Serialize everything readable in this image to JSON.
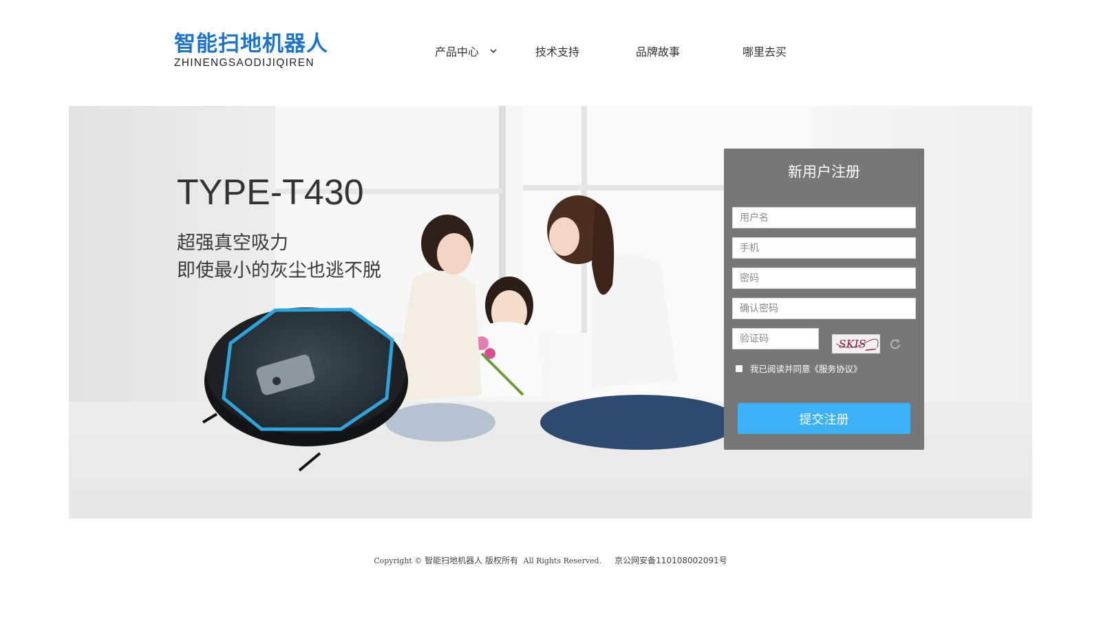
{
  "header": {
    "logo_cn": "智能扫地机器人",
    "logo_en": "ZHINENGSAODIJIQIREN",
    "brand_color": "#1f73c4",
    "nav": [
      {
        "label": "产品中心",
        "has_dropdown": true
      },
      {
        "label": "技术支持"
      },
      {
        "label": "品牌故事"
      },
      {
        "label": "哪里去买"
      }
    ]
  },
  "banner": {
    "model": "TYPE-T430",
    "slogan_line1": "超强真空吸力",
    "slogan_line2": "即使最小的灰尘也逃不脱"
  },
  "register": {
    "title": "新用户注册",
    "username_placeholder": "用户名",
    "phone_placeholder": "手机",
    "password_placeholder": "密码",
    "confirm_placeholder": "确认密码",
    "code_placeholder": "验证码",
    "captcha_text": "SKIS",
    "agree_text": "我已阅读并同意《服务协议》",
    "submit_label": "提交注册",
    "panel_color": "#777777",
    "submit_color": "#3cb1f8"
  },
  "footer": {
    "copyright_prefix": "Copyright ©",
    "brand": "智能扫地机器人",
    "rights_cn": "版权所有",
    "rights_en": "All Rights Reserved.",
    "icp": "京公网安备110108002091号"
  }
}
